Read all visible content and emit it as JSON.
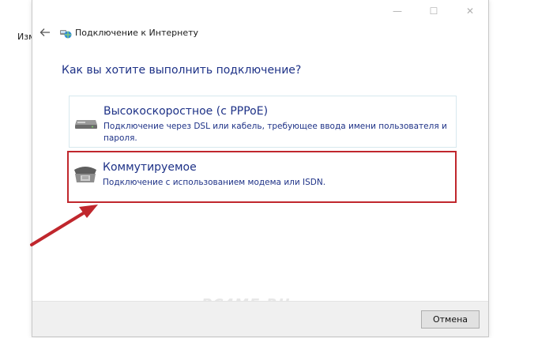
{
  "background": {
    "fragment_text": "Изм"
  },
  "window": {
    "title": "Подключение к Интернету",
    "caption_buttons": {
      "minimize": "—",
      "maximize": "☐",
      "close": "✕"
    }
  },
  "main": {
    "question": "Как вы хотите выполнить подключение?",
    "options": [
      {
        "title": "Высокоскоростное (с PPPoE)",
        "description": "Подключение через DSL или кабель, требующее ввода имени пользователя и пароля.",
        "icon": "modem-icon"
      },
      {
        "title": "Коммутируемое",
        "description": "Подключение с использованием модема или ISDN.",
        "icon": "dialup-phone-icon",
        "highlighted": true
      }
    ]
  },
  "annotation": {
    "arrow_color": "#c0272d"
  },
  "watermark": "PC4ME.RU",
  "footer": {
    "cancel_label": "Отмена"
  },
  "colors": {
    "link_blue": "#1e3287",
    "highlight_red": "#c0272d",
    "footer_bg": "#f0f0f0"
  }
}
